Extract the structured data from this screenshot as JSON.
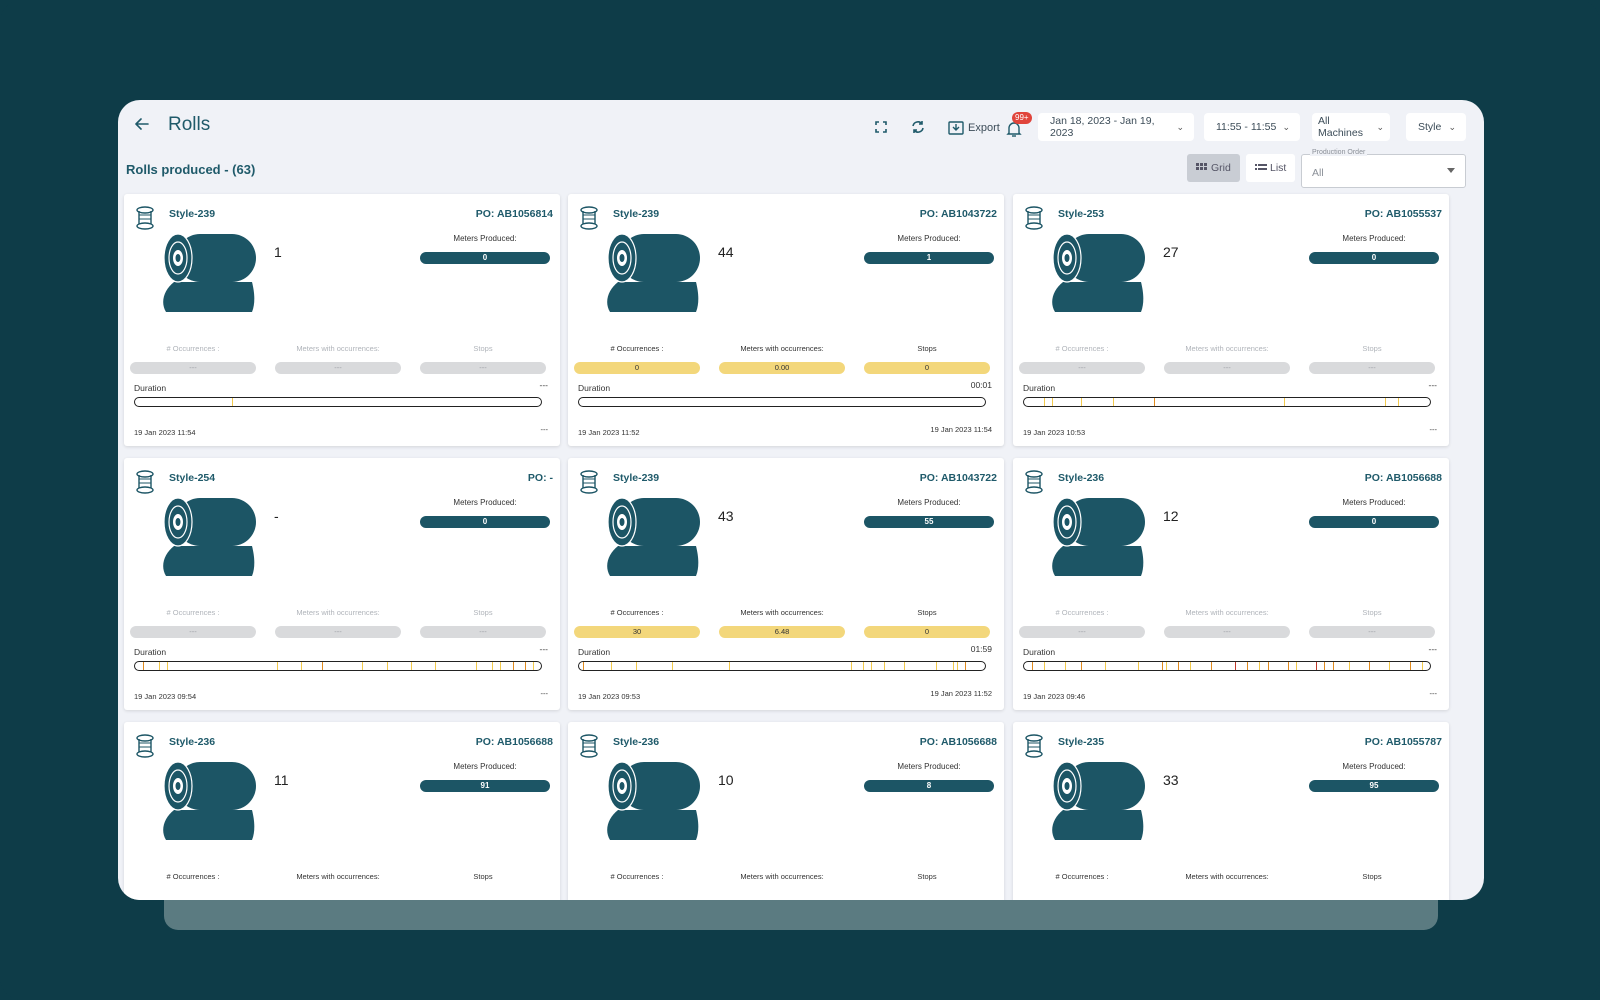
{
  "header": {
    "title": "Rolls",
    "export_label": "Export",
    "notification_count": "99+",
    "date_range": "Jan 18, 2023 - Jan 19, 2023",
    "time_range": "11:55 - 11:55",
    "machines": "All Machines",
    "group_by": "Style"
  },
  "subbar": {
    "rolls_produced": "Rolls produced - (63)",
    "grid_label": "Grid",
    "list_label": "List",
    "production_order_label": "Production Order",
    "production_order_value": "All"
  },
  "labels": {
    "meters_produced": "Meters Produced:",
    "occurrences": "# Occurrences :",
    "meters_with_occurrences": "Meters with occurrences:",
    "stops": "Stops",
    "duration": "Duration"
  },
  "colors": {
    "brand_teal": "#1c5565",
    "active_stat": "#f3d77b",
    "inactive_stat": "#d9dadc",
    "tick_orange": "#e08a1e",
    "tick_yellow": "#f2c94c",
    "tick_red": "#c0392b"
  },
  "cards": [
    {
      "style": "Style-239",
      "po": "PO: AB1056814",
      "count": "1",
      "meters": "0",
      "active": false,
      "occurrences": "---",
      "meters_occ": "---",
      "stops": "---",
      "duration": "---",
      "start": "19 Jan 2023 11:54",
      "end": "---",
      "ticks": [
        {
          "pos": 0.24,
          "color": "yellow"
        }
      ]
    },
    {
      "style": "Style-239",
      "po": "PO: AB1043722",
      "count": "44",
      "meters": "1",
      "active": true,
      "occurrences": "0",
      "meters_occ": "0.00",
      "stops": "0",
      "duration": "00:01",
      "start": "19 Jan 2023 11:52",
      "end": "19 Jan 2023 11:54",
      "ticks": []
    },
    {
      "style": "Style-253",
      "po": "PO: AB1055537",
      "count": "27",
      "meters": "0",
      "active": false,
      "occurrences": "---",
      "meters_occ": "---",
      "stops": "---",
      "duration": "---",
      "start": "19 Jan 2023 10:53",
      "end": "---",
      "ticks": [
        {
          "pos": 0.05,
          "color": "yellow"
        },
        {
          "pos": 0.07,
          "color": "yellow"
        },
        {
          "pos": 0.14,
          "color": "yellow"
        },
        {
          "pos": 0.22,
          "color": "yellow"
        },
        {
          "pos": 0.32,
          "color": "orange"
        },
        {
          "pos": 0.64,
          "color": "yellow"
        },
        {
          "pos": 0.89,
          "color": "yellow"
        },
        {
          "pos": 0.92,
          "color": "yellow"
        }
      ]
    },
    {
      "style": "Style-254",
      "po": "PO: -",
      "count": "-",
      "meters": "0",
      "active": false,
      "occurrences": "---",
      "meters_occ": "---",
      "stops": "---",
      "duration": "---",
      "start": "19 Jan 2023 09:54",
      "end": "---",
      "ticks": [
        {
          "pos": 0.02,
          "color": "orange"
        },
        {
          "pos": 0.06,
          "color": "yellow"
        },
        {
          "pos": 0.08,
          "color": "yellow"
        },
        {
          "pos": 0.35,
          "color": "yellow"
        },
        {
          "pos": 0.41,
          "color": "yellow"
        },
        {
          "pos": 0.46,
          "color": "orange"
        },
        {
          "pos": 0.56,
          "color": "yellow"
        },
        {
          "pos": 0.62,
          "color": "yellow"
        },
        {
          "pos": 0.68,
          "color": "yellow"
        },
        {
          "pos": 0.74,
          "color": "yellow"
        },
        {
          "pos": 0.84,
          "color": "yellow"
        },
        {
          "pos": 0.88,
          "color": "yellow"
        },
        {
          "pos": 0.9,
          "color": "yellow"
        },
        {
          "pos": 0.93,
          "color": "orange"
        },
        {
          "pos": 0.96,
          "color": "orange"
        },
        {
          "pos": 0.98,
          "color": "yellow"
        }
      ]
    },
    {
      "style": "Style-239",
      "po": "PO: AB1043722",
      "count": "43",
      "meters": "55",
      "active": true,
      "occurrences": "30",
      "meters_occ": "6.48",
      "stops": "0",
      "duration": "01:59",
      "start": "19 Jan 2023 09:53",
      "end": "19 Jan 2023 11:52",
      "ticks": [
        {
          "pos": 0.01,
          "color": "orange"
        },
        {
          "pos": 0.08,
          "color": "yellow"
        },
        {
          "pos": 0.14,
          "color": "yellow"
        },
        {
          "pos": 0.23,
          "color": "yellow"
        },
        {
          "pos": 0.37,
          "color": "yellow"
        },
        {
          "pos": 0.67,
          "color": "yellow"
        },
        {
          "pos": 0.7,
          "color": "yellow"
        },
        {
          "pos": 0.72,
          "color": "yellow"
        },
        {
          "pos": 0.75,
          "color": "yellow"
        },
        {
          "pos": 0.8,
          "color": "yellow"
        },
        {
          "pos": 0.88,
          "color": "yellow"
        },
        {
          "pos": 0.92,
          "color": "yellow"
        },
        {
          "pos": 0.93,
          "color": "yellow"
        },
        {
          "pos": 0.95,
          "color": "orange"
        }
      ]
    },
    {
      "style": "Style-236",
      "po": "PO: AB1056688",
      "count": "12",
      "meters": "0",
      "active": false,
      "occurrences": "---",
      "meters_occ": "---",
      "stops": "---",
      "duration": "---",
      "start": "19 Jan 2023 09:46",
      "end": "---",
      "ticks": [
        {
          "pos": 0.02,
          "color": "orange"
        },
        {
          "pos": 0.05,
          "color": "yellow"
        },
        {
          "pos": 0.1,
          "color": "yellow"
        },
        {
          "pos": 0.14,
          "color": "orange"
        },
        {
          "pos": 0.2,
          "color": "yellow"
        },
        {
          "pos": 0.28,
          "color": "yellow"
        },
        {
          "pos": 0.34,
          "color": "orange"
        },
        {
          "pos": 0.35,
          "color": "yellow"
        },
        {
          "pos": 0.38,
          "color": "orange"
        },
        {
          "pos": 0.41,
          "color": "yellow"
        },
        {
          "pos": 0.46,
          "color": "orange"
        },
        {
          "pos": 0.52,
          "color": "red"
        },
        {
          "pos": 0.55,
          "color": "orange"
        },
        {
          "pos": 0.58,
          "color": "yellow"
        },
        {
          "pos": 0.6,
          "color": "orange"
        },
        {
          "pos": 0.65,
          "color": "orange"
        },
        {
          "pos": 0.67,
          "color": "yellow"
        },
        {
          "pos": 0.72,
          "color": "red"
        },
        {
          "pos": 0.74,
          "color": "orange"
        },
        {
          "pos": 0.76,
          "color": "orange"
        },
        {
          "pos": 0.8,
          "color": "yellow"
        },
        {
          "pos": 0.85,
          "color": "orange"
        },
        {
          "pos": 0.9,
          "color": "yellow"
        },
        {
          "pos": 0.95,
          "color": "orange"
        },
        {
          "pos": 0.98,
          "color": "yellow"
        }
      ]
    },
    {
      "style": "Style-236",
      "po": "PO: AB1056688",
      "count": "11",
      "meters": "91",
      "active": true,
      "occurrences": "",
      "meters_occ": "",
      "stops": "",
      "duration": "",
      "start": "",
      "end": "",
      "ticks": []
    },
    {
      "style": "Style-236",
      "po": "PO: AB1056688",
      "count": "10",
      "meters": "8",
      "active": true,
      "occurrences": "",
      "meters_occ": "",
      "stops": "",
      "duration": "",
      "start": "",
      "end": "",
      "ticks": []
    },
    {
      "style": "Style-235",
      "po": "PO: AB1055787",
      "count": "33",
      "meters": "95",
      "active": true,
      "occurrences": "",
      "meters_occ": "",
      "stops": "",
      "duration": "",
      "start": "",
      "end": "",
      "ticks": []
    }
  ]
}
